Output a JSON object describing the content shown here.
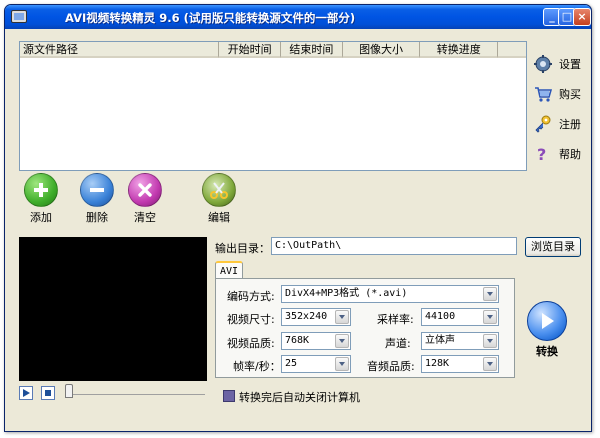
{
  "window": {
    "title": "AVI视频转换精灵 9.6 (试用版只能转换源文件的一部分)",
    "minimize_glyph": "_",
    "maximize_glyph": "□",
    "close_glyph": "×"
  },
  "file_list": {
    "columns": [
      "源文件路径",
      "开始时间",
      "结束时间",
      "图像大小",
      "转换进度"
    ],
    "rows": []
  },
  "side_menu": {
    "settings": "设置",
    "buy": "购买",
    "register": "注册",
    "help": "帮助"
  },
  "toolbar": {
    "add": "添加",
    "delete": "删除",
    "clear": "清空",
    "edit": "编辑"
  },
  "output": {
    "label": "输出目录：",
    "path": "C:\\OutPath\\",
    "browse": "浏览目录"
  },
  "tab": {
    "label": "AVI"
  },
  "settings": {
    "encoding_label": "编码方式:",
    "encoding_value": "DivX4+MP3格式 (*.avi)",
    "size_label": "视频尺寸:",
    "size_value": "352x240",
    "quality_label": "视频品质:",
    "quality_value": "768K",
    "fps_label": "帧率/秒：",
    "fps_value": "25",
    "samplerate_label": "采样率:",
    "samplerate_value": "44100",
    "channel_label": "声道:",
    "channel_value": "立体声",
    "audio_quality_label": "音频品质:",
    "audio_quality_value": "128K"
  },
  "convert": {
    "label": "转换"
  },
  "shutdown": {
    "label": "转换完后自动关闭计算机"
  },
  "colors": {
    "titlebar": "#0054e3",
    "window_bg": "#ece9d8",
    "add": "#3fae2a",
    "delete": "#3a82d8",
    "clear": "#c23ab0",
    "convert": "#1e6ad6"
  }
}
